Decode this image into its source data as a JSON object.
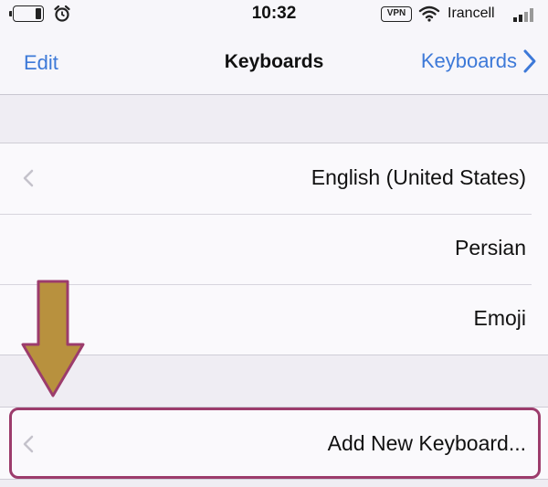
{
  "status_bar": {
    "time": "10:32",
    "carrier": "Irancell",
    "vpn": "VPN",
    "icons": [
      "battery-icon",
      "alarm-icon",
      "wifi-icon",
      "signal-icon"
    ]
  },
  "nav_bar": {
    "back_label": "Keyboards",
    "title": "Keyboards",
    "edit_label": "Edit"
  },
  "keyboards": [
    {
      "label": "English (United States)",
      "has_chevron": true
    },
    {
      "label": "Persian",
      "has_chevron": false
    },
    {
      "label": "Emoji",
      "has_chevron": false
    }
  ],
  "add_keyboard": {
    "label": "Add New Keyboard..."
  },
  "colors": {
    "accent": "#3d79d8",
    "highlight": "#9c3c6c",
    "arrow_fill": "#b8913e",
    "arrow_stroke": "#9c3c6c",
    "background": "#efedf3"
  }
}
